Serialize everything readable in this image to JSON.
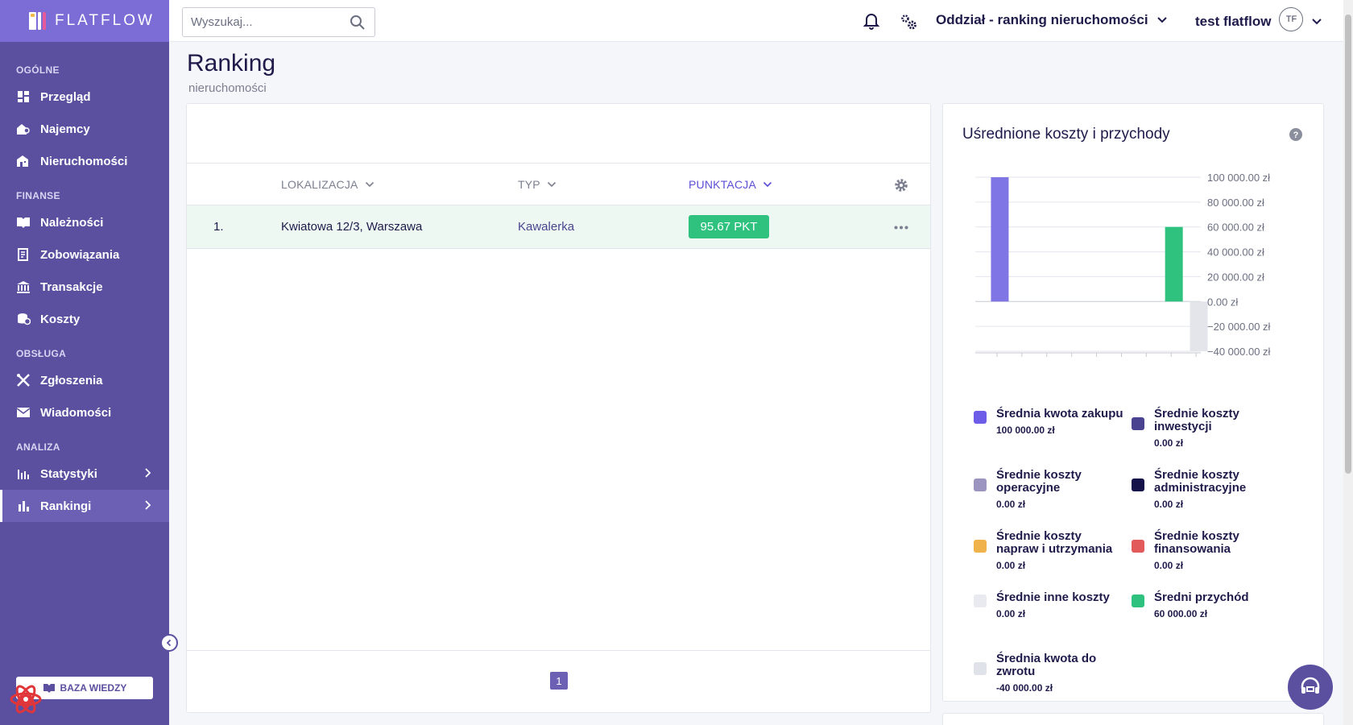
{
  "app": {
    "logo_text": "FLATFLOW",
    "brand_color": "#7b6cd6",
    "sidebar_color": "#5b4fa0"
  },
  "sidebar": {
    "sections": [
      {
        "title": "OGÓLNE",
        "items": [
          {
            "label": "Przegląd",
            "icon": "dashboard-icon"
          },
          {
            "label": "Najemcy",
            "icon": "tenant-icon"
          },
          {
            "label": "Nieruchomości",
            "icon": "buildings-icon"
          }
        ]
      },
      {
        "title": "FINANSE",
        "items": [
          {
            "label": "Należności",
            "icon": "book-icon"
          },
          {
            "label": "Zobowiązania",
            "icon": "receipt-icon"
          },
          {
            "label": "Transakcje",
            "icon": "bank-icon"
          },
          {
            "label": "Koszty",
            "icon": "coins-icon"
          }
        ]
      },
      {
        "title": "OBSŁUGA",
        "items": [
          {
            "label": "Zgłoszenia",
            "icon": "tools-icon"
          },
          {
            "label": "Wiadomości",
            "icon": "mail-icon"
          }
        ]
      },
      {
        "title": "ANALIZA",
        "items": [
          {
            "label": "Statystyki",
            "icon": "stats-icon"
          },
          {
            "label": "Rankingi",
            "icon": "bar-chart-icon",
            "active": true
          }
        ]
      }
    ],
    "knowledge_base": "BAZA WIEDZY"
  },
  "topbar": {
    "search_placeholder": "Wyszukaj...",
    "branch": "Oddział - ranking nieruchomości",
    "user_name": "test flatflow",
    "user_initials": "TF"
  },
  "page": {
    "title": "Ranking",
    "subtitle": "nieruchomości"
  },
  "table": {
    "columns": [
      {
        "label": "LOKALIZACJA",
        "color": "#7c7f8f"
      },
      {
        "label": "TYP",
        "color": "#7c7f8f"
      },
      {
        "label": "PUNKTACJA",
        "color": "#5b4fd6"
      }
    ],
    "rows": [
      {
        "rank": "1.",
        "location": "Kwiatowa 12/3, Warszawa",
        "type": "Kawalerka",
        "score": "95.67 PKT"
      }
    ],
    "current_page": "1"
  },
  "chart": {
    "title": "Uśrednione koszty i przychody",
    "legend": [
      {
        "name": "Średnia kwota zakupu",
        "value": "100 000.00 zł",
        "color": "#6c5ce7"
      },
      {
        "name": "Średnie koszty inwestycji",
        "value": "0.00 zł",
        "color": "#4a4490"
      },
      {
        "name": "Średnie koszty operacyjne",
        "value": "0.00 zł",
        "color": "#9b93c0"
      },
      {
        "name": "Średnie koszty administracyjne",
        "value": "0.00 zł",
        "color": "#15124a"
      },
      {
        "name": "Średnie koszty napraw i utrzymania",
        "value": "0.00 zł",
        "color": "#f0b24a"
      },
      {
        "name": "Średnie koszty finansowania",
        "value": "0.00 zł",
        "color": "#e25a5a"
      },
      {
        "name": "Średnie inne koszty",
        "value": "0.00 zł",
        "color": "#e8eaf0"
      },
      {
        "name": "Średni przychód",
        "value": "60 000.00 zł",
        "color": "#2ec27e"
      },
      {
        "name": "Średnia kwota do zwrotu",
        "value": "-40 000.00 zł",
        "color": "#dfe2e8"
      }
    ]
  },
  "chart_data": {
    "type": "bar",
    "title": "Uśrednione koszty i przychody",
    "categories": [
      "Średnia kwota zakupu",
      "Średnie koszty inwestycji",
      "Średnie koszty operacyjne",
      "Średnie koszty administracyjne",
      "Średnie koszty napraw i utrzymania",
      "Średnie koszty finansowania",
      "Średnie inne koszty",
      "Średni przychód",
      "Średnia kwota do zwrotu"
    ],
    "values": [
      100000,
      0,
      0,
      0,
      0,
      0,
      0,
      60000,
      -40000
    ],
    "colors": [
      "#8075e5",
      "#4a4490",
      "#9b93c0",
      "#15124a",
      "#f0b24a",
      "#e25a5a",
      "#e8eaf0",
      "#2ec27e",
      "#e3e5ea"
    ],
    "ylim": [
      -40000,
      100000
    ],
    "yticks": [
      100000,
      80000,
      60000,
      40000,
      20000,
      0,
      -20000,
      -40000
    ],
    "ytick_labels": [
      "100 000.00 zł",
      "80 000.00 zł",
      "60 000.00 zł",
      "40 000.00 zł",
      "20 000.00 zł",
      "0.00 zł",
      "−20 000.00 zł",
      "−40 000.00 zł"
    ],
    "grid": true,
    "axis_side": "right"
  }
}
